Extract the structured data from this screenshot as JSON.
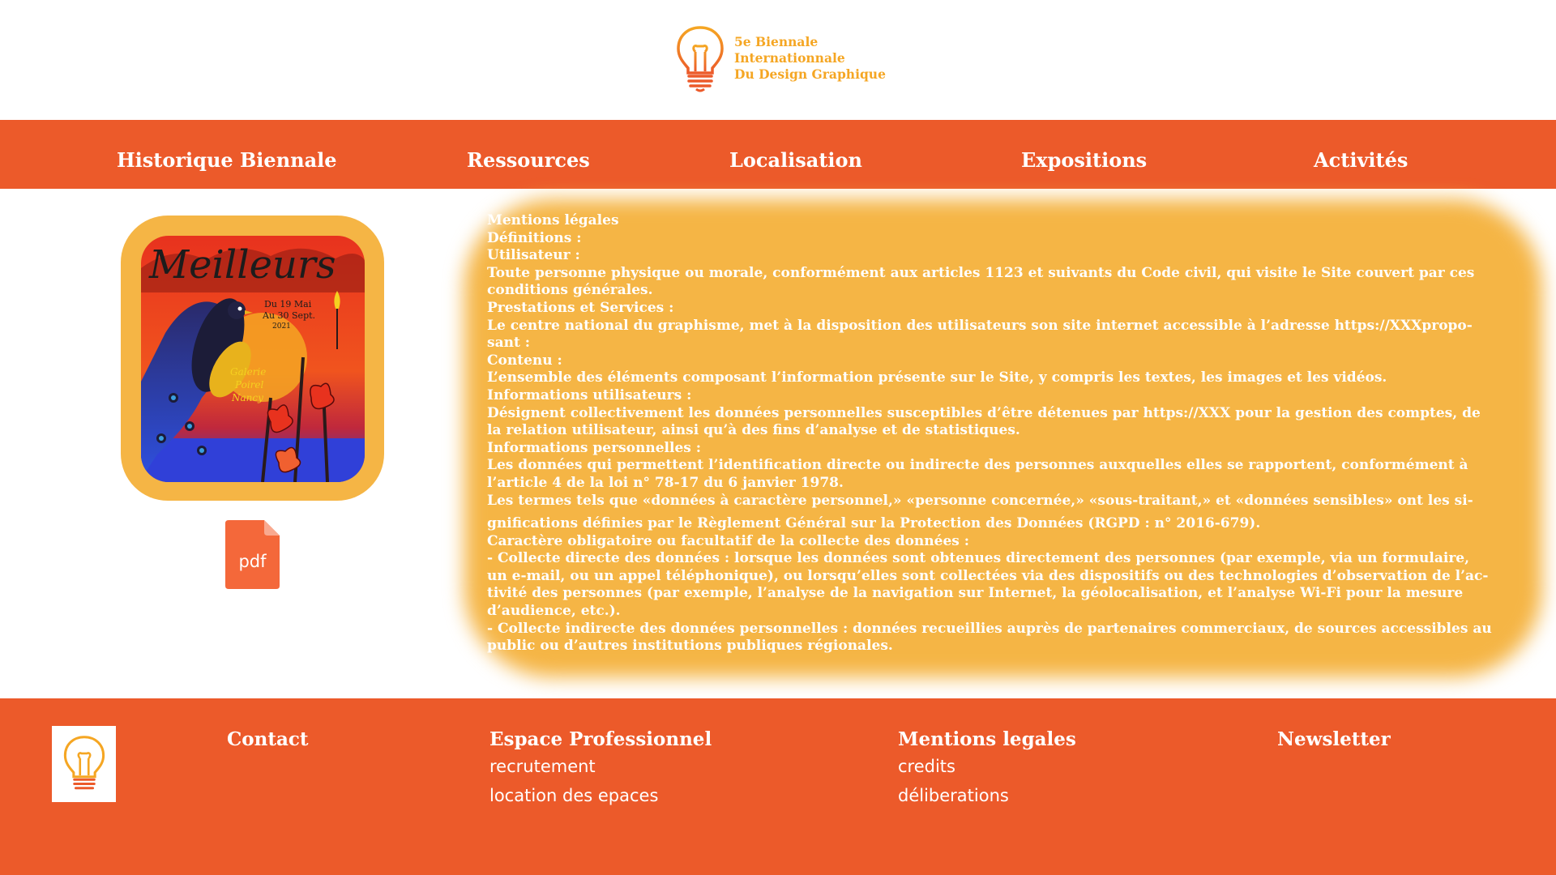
{
  "brand": {
    "line1": "5e Biennale",
    "line2": "Internationnale",
    "line3": "Du Design Graphique",
    "icon": "lightbulb-icon",
    "color": "#f5a623"
  },
  "nav": {
    "items": [
      {
        "label": "Historique Biennale"
      },
      {
        "label": "Ressources"
      },
      {
        "label": "Localisation"
      },
      {
        "label": "Expositions"
      },
      {
        "label": "Activités"
      }
    ],
    "bg_color": "#ec5a2a"
  },
  "poster": {
    "title": "Meilleurs",
    "dates": [
      "Du 19 Mai",
      "Au 30 Sept.",
      "2021"
    ],
    "venue": [
      "Galerie",
      "Poirel",
      "Nancy"
    ],
    "frame_color": "#f5b545"
  },
  "pdf_icon": {
    "label": "pdf",
    "icon": "pdf-file-icon"
  },
  "legal": {
    "lines": [
      "Mentions légales",
      "Définitions :",
      "Utilisateur :",
      "Toute personne physique ou morale, conformément aux articles 1123 et suivants du Code civil, qui visite le Site couvert par ces",
      "conditions générales.",
      "Prestations et Services :",
      "Le centre national du graphisme, met à la disposition des utilisateurs son site internet accessible à l’adresse https://XXXpropo-",
      "sant :",
      "Contenu :",
      "L’ensemble des éléments composant l’information présente sur le Site, y compris les textes, les images et les vidéos.",
      "Informations utilisateurs :",
      "Désignent collectivement les données personnelles susceptibles d’être détenues par https://XXX pour la gestion des comptes, de",
      "la relation utilisateur, ainsi qu’à des fins d’analyse et de statistiques.",
      "Informations personnelles :",
      "Les données qui permettent l’identification directe ou indirecte des personnes auxquelles elles se rapportent, conformément à",
      "l’article 4 de la loi n° 78-17 du 6 janvier 1978.",
      "Les termes tels que «données à caractère personnel,» «personne concernée,» «sous-traitant,» et «données sensibles» ont les si-",
      "gnifications définies par le Règlement Général sur la Protection des Données (RGPD : n° 2016-679).",
      "Caractère obligatoire ou facultatif de la collecte des données :",
      "- Collecte directe des données : lorsque les données sont obtenues directement des personnes (par exemple, via un formulaire,",
      "un e-mail, ou un appel téléphonique), ou lorsqu’elles sont collectées via des dispositifs ou des technologies d’observation de l’ac-",
      "tivité des personnes (par exemple, l’analyse de la navigation sur Internet, la géolocalisation, et l’analyse Wi-Fi pour la mesure",
      "d’audience, etc.).",
      "- Collecte indirecte des données personnelles : données recueillies auprès de partenaires commerciaux, de sources accessibles au",
      "public ou d’autres institutions publiques régionales."
    ],
    "bg_color": "#f5b545"
  },
  "footer": {
    "logo_icon": "lightbulb-icon",
    "contact": "Contact",
    "pro": {
      "title": "Espace Professionnel",
      "links": [
        "recrutement",
        "location des epaces"
      ]
    },
    "mentions": {
      "title": "Mentions legales",
      "links": [
        "credits",
        "déliberations"
      ]
    },
    "newsletter": "Newsletter",
    "bg_color": "#ec5a2a"
  }
}
